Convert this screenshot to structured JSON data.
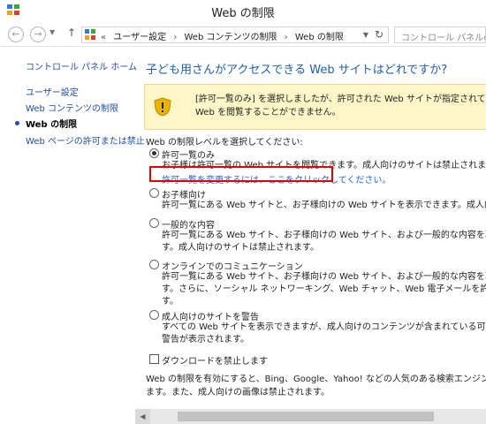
{
  "window": {
    "title": "Web の制限"
  },
  "address_bar": {
    "breadcrumb_prefix": "«",
    "crumbs": [
      "ユーザー設定",
      "Web コンテンツの制限",
      "Web の制限"
    ],
    "separator": "›",
    "search_placeholder": "コントロール パネルの検索"
  },
  "sidebar": {
    "home": "コントロール パネル ホーム",
    "items": [
      {
        "label": "ユーザー設定"
      },
      {
        "label": "Web コンテンツの制限"
      },
      {
        "label": "Web の制限",
        "current": true
      },
      {
        "label": "Web ページの許可または禁止"
      }
    ]
  },
  "main": {
    "heading": "子ども用さんがアクセスできる Web サイトはどれですか?",
    "warning": {
      "line1": "[許可一覧のみ] を選択しましたが、許可された Web サイトが指定されていません。このオ",
      "line2": "Web を閲覧することができません。"
    },
    "level_label": "Web の制限レベルを選択してください:",
    "options": [
      {
        "label": "許可一覧のみ",
        "selected": true,
        "desc": [
          "お子様は許可一覧の Web サイトを閲覧できます。成人向けのサイトは禁止されます。"
        ],
        "link": "許可一覧を変更するには、ここをクリックしてください。"
      },
      {
        "label": "お子様向け",
        "selected": false,
        "desc": [
          "許可一覧にある Web サイトと、お子様向けの Web サイトを表示できます。成人向けのサイトは禁"
        ]
      },
      {
        "label": "一般的な内容",
        "selected": false,
        "desc": [
          "許可一覧にある Web サイト、お子様向けの Web サイト、および一般的な内容を取り扱う Web",
          "す。成人向けのサイトは禁止されます。"
        ]
      },
      {
        "label": "オンラインでのコミュニケーション",
        "selected": false,
        "desc": [
          "許可一覧にある Web サイト、お子様向けの Web サイト、および一般的な内容を取り扱う Web",
          "す。さらに、ソーシャル ネットワーキング、Web チャット、Web 電子メールを許可されます。成人",
          "す。"
        ]
      },
      {
        "label": "成人向けのサイトを警告",
        "selected": false,
        "desc": [
          "すべての Web サイトを表示できますが、成人向けのコンテンツが含まれている可能性のあるサイト",
          "警告が表示されます。"
        ]
      }
    ],
    "download_block_label": "ダウンロードを禁止します",
    "download_block_checked": false,
    "footer": [
      "Web の制限を有効にすると、Bing、Google、Yahoo! などの人気のある検索エンジンのセーフサーチ",
      "ます。また、成人向けの画像は禁止されます。"
    ]
  },
  "colors": {
    "link": "#1f4ea8",
    "heading": "#1f5fa8",
    "warning_bg": "#fff6c8",
    "highlight_box": "#e00000"
  },
  "icons": {
    "app": "control-panel-icon",
    "back": "back-arrow-icon",
    "forward": "forward-arrow-icon",
    "up": "up-arrow-icon",
    "refresh": "refresh-icon",
    "warning": "warning-shield-icon"
  }
}
